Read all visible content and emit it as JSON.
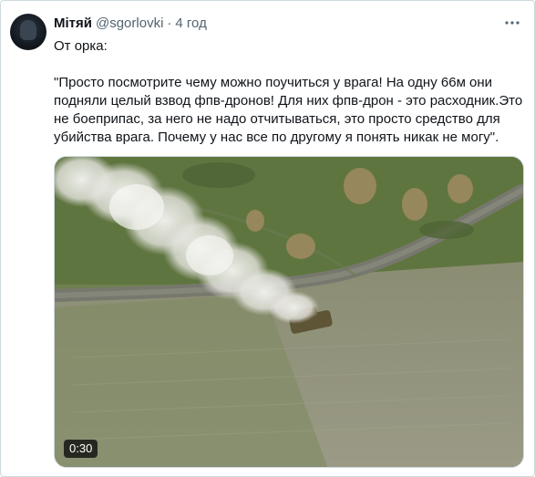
{
  "tweet": {
    "display_name": "Мітяй",
    "handle": "@sgorlovki",
    "separator": "·",
    "time": "4 год",
    "lead": "От орка:",
    "body": "\"Просто посмотрите чему можно поучиться у врага! На одну 66м они подняли целый взвод фпв-дронов! Для них фпв-дрон - это расходник.Это не боеприпас, за него не надо отчитываться, это просто средство для убийства врага. Почему у нас все по другому я понять никак не могу\".",
    "avatar_icon": "avatar-image",
    "more_icon": "more-dots-icon"
  },
  "media": {
    "type": "video",
    "duration": "0:30"
  }
}
